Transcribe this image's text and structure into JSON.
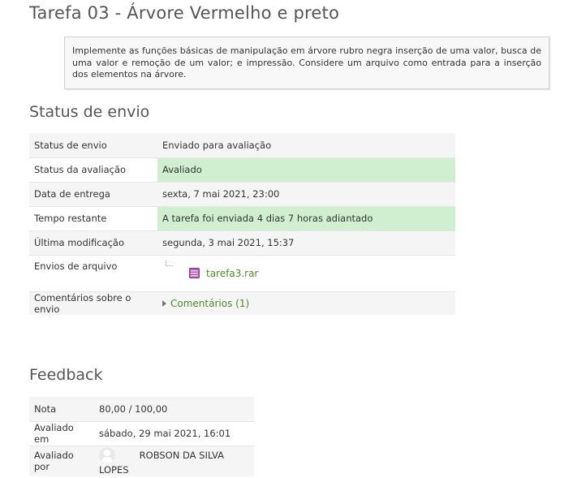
{
  "page": {
    "title": "Tarefa 03 - Árvore Vermelho e preto",
    "intro": "Implemente as funções básicas de manipulação em árvore rubro negra inserção de uma valor, busca de uma valor e remoção de um valor; e impressão. Considere um arquivo como entrada para a inserção dos elementos na árvore."
  },
  "submission_status": {
    "heading": "Status de envio",
    "rows": {
      "status": {
        "label": "Status de envio",
        "value": "Enviado para avaliação"
      },
      "grading_status": {
        "label": "Status da avaliação",
        "value": "Avaliado"
      },
      "due_date": {
        "label": "Data de entrega",
        "value": "sexta, 7 mai 2021, 23:00"
      },
      "time_remaining": {
        "label": "Tempo restante",
        "value": "A tarefa foi enviada 4 dias 7 horas adiantado"
      },
      "last_modified": {
        "label": "Última modificação",
        "value": "segunda, 3 mai 2021, 15:37"
      },
      "file_submissions": {
        "label": "Envios de arquivo",
        "file_name": "tarefa3.rar",
        "file_icon": "archive-icon"
      },
      "comments": {
        "label": "Comentários sobre o envio",
        "link": "Comentários (1)"
      }
    }
  },
  "feedback": {
    "heading": "Feedback",
    "rows": {
      "grade": {
        "label": "Nota",
        "value": "80,00 / 100,00"
      },
      "graded_on": {
        "label": "Avaliado em",
        "value": "sábado, 29 mai 2021, 16:01"
      },
      "graded_by": {
        "label": "Avaliado por",
        "value": "ROBSON DA SILVA LOPES"
      }
    }
  },
  "colors": {
    "success_bg": "#d0efd0",
    "link": "#4e8a2a",
    "alt_row_bg": "#f5f5f5"
  }
}
